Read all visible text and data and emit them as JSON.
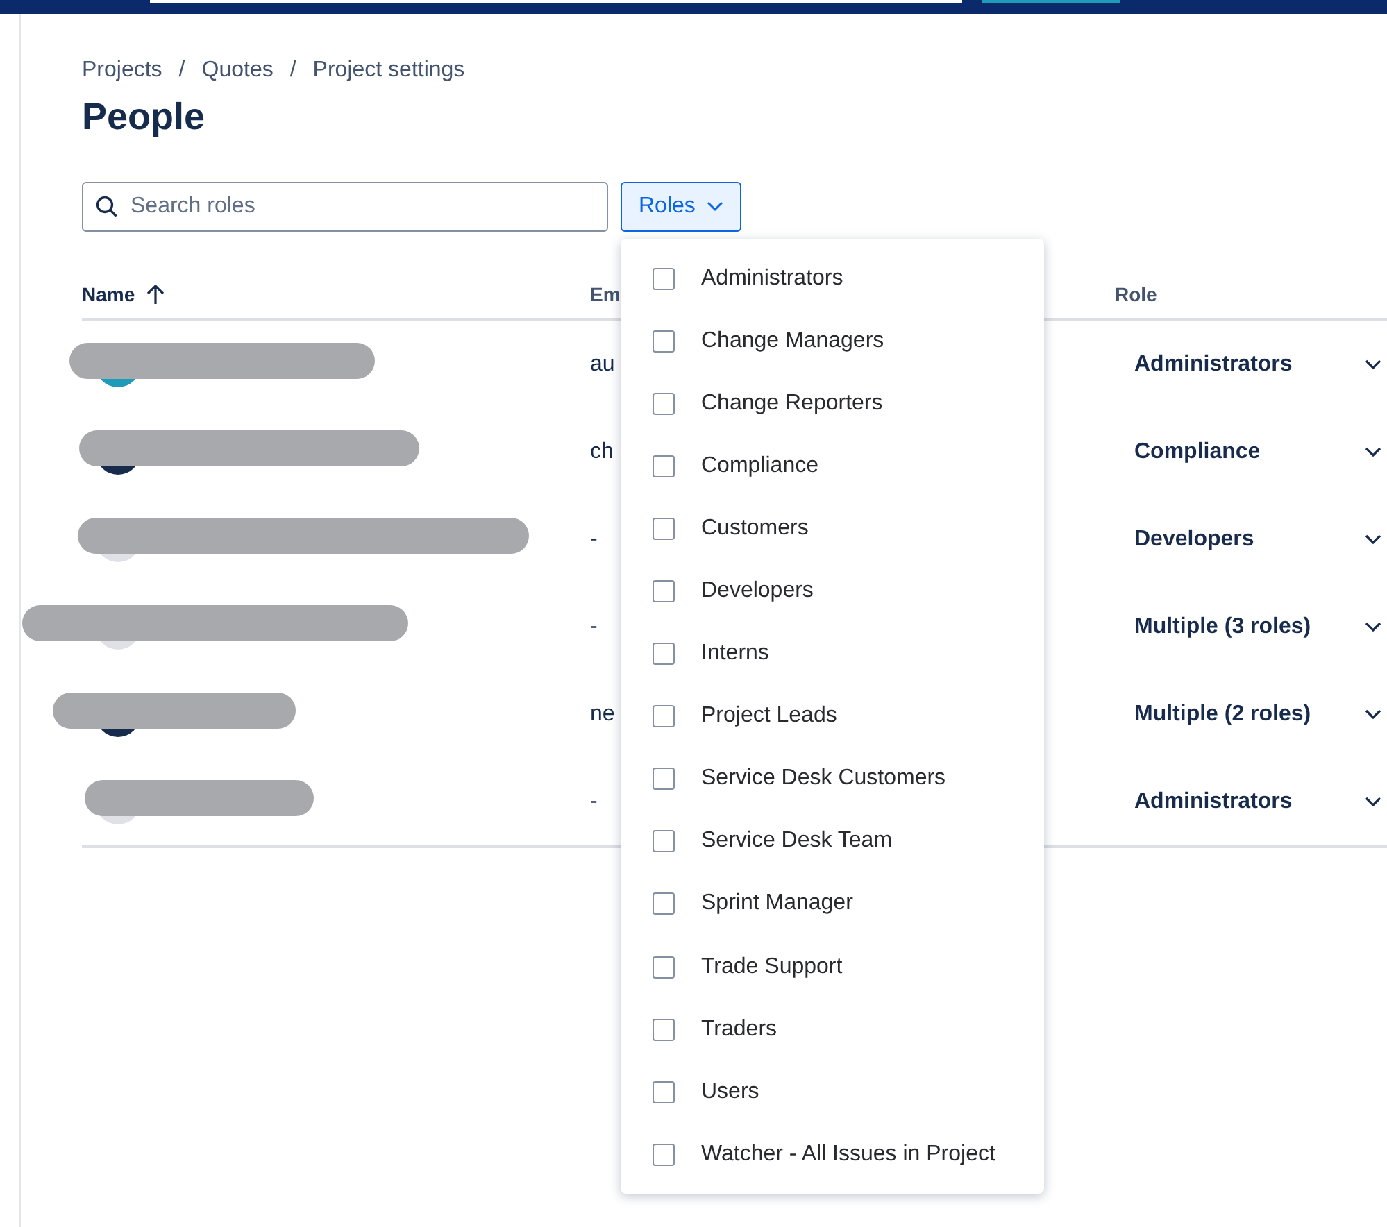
{
  "breadcrumbs": [
    "Projects",
    "Quotes",
    "Project settings"
  ],
  "breadcrumb_separators": [
    "/",
    "/"
  ],
  "title": "People",
  "search": {
    "placeholder": "Search roles"
  },
  "roles_filter": {
    "label": "Roles",
    "expanded": true
  },
  "table": {
    "columns": [
      {
        "label": "Name",
        "sorted": true
      },
      {
        "label": "Em",
        "sorted": false
      },
      {
        "label": "Role",
        "sorted": false
      }
    ],
    "rows": [
      {
        "color": "#1d9bb8",
        "email": "au",
        "role": "Administrators"
      },
      {
        "color": "#172b4d",
        "email": "ch",
        "role": "Compliance"
      },
      {
        "color": "#dfe1e6",
        "email": "-",
        "role": "Developers"
      },
      {
        "color": "#dfe1e6",
        "email": "-",
        "role": "Multiple (3 roles)"
      },
      {
        "color": "#172b4d",
        "email": "ne",
        "role": "Multiple (2 roles)"
      },
      {
        "color": "#dfe1e6",
        "email": "-",
        "role": "Administrators"
      }
    ]
  },
  "roles_menu": [
    {
      "label": "Administrators",
      "checked": false
    },
    {
      "label": "Change Managers",
      "checked": false
    },
    {
      "label": "Change Reporters",
      "checked": false
    },
    {
      "label": "Compliance",
      "checked": false
    },
    {
      "label": "Customers",
      "checked": false
    },
    {
      "label": "Developers",
      "checked": false
    },
    {
      "label": "Interns",
      "checked": false
    },
    {
      "label": "Project Leads",
      "checked": false
    },
    {
      "label": "Service Desk Customers",
      "checked": false
    },
    {
      "label": "Service Desk Team",
      "checked": false
    },
    {
      "label": "Sprint Manager",
      "checked": false
    },
    {
      "label": "Trade Support",
      "checked": false
    },
    {
      "label": "Traders",
      "checked": false
    },
    {
      "label": "Users",
      "checked": false
    },
    {
      "label": "Watcher - All Issues in Project",
      "checked": false
    }
  ]
}
